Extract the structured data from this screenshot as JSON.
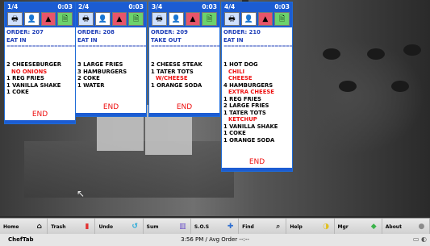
{
  "tickets": [
    {
      "count": "1/4",
      "time": "0:03",
      "order": "ORDER: 207",
      "type": "EAT IN",
      "dashes": "=========================",
      "items": [
        {
          "text": "2 CHEESEBURGER",
          "mod": false
        },
        {
          "text": "NO ONIONS",
          "mod": true
        },
        {
          "text": "1 REG FRIES",
          "mod": false
        },
        {
          "text": "1 VANILLA SHAKE",
          "mod": false
        },
        {
          "text": "1 COKE",
          "mod": false
        }
      ],
      "end": "END"
    },
    {
      "count": "2/4",
      "time": "0:03",
      "order": "ORDER: 208",
      "type": "EAT IN",
      "dashes": "=========================",
      "items": [
        {
          "text": "3 LARGE FRIES",
          "mod": false
        },
        {
          "text": "3 HAMBURGERS",
          "mod": false
        },
        {
          "text": "2 COKE",
          "mod": false
        },
        {
          "text": "1 WATER",
          "mod": false
        }
      ],
      "end": "END"
    },
    {
      "count": "3/4",
      "time": "0:03",
      "order": "ORDER: 209",
      "type": "TAKE OUT",
      "dashes": "=========================",
      "items": [
        {
          "text": "2 CHEESE STEAK",
          "mod": false
        },
        {
          "text": "1 TATER TOTS",
          "mod": false
        },
        {
          "text": "W/CHEESE",
          "mod": true
        },
        {
          "text": "1 ORANGE SODA",
          "mod": false
        }
      ],
      "end": "END"
    },
    {
      "count": "4/4",
      "time": "0:03",
      "order": "ORDER: 210",
      "type": "EAT IN",
      "dashes": "=========================",
      "items": [
        {
          "text": "1 HOT DOG",
          "mod": false
        },
        {
          "text": "CHILI",
          "mod": true
        },
        {
          "text": "CHEESE",
          "mod": true
        },
        {
          "text": "4 HAMBURGERS",
          "mod": false
        },
        {
          "text": "EXTRA CHEESE",
          "mod": true
        },
        {
          "text": "1 REG FRIES",
          "mod": false
        },
        {
          "text": "2 LARGE FRIES",
          "mod": false
        },
        {
          "text": "1 TATER TOTS",
          "mod": false
        },
        {
          "text": "KETCHUP",
          "mod": true
        },
        {
          "text": "1 VANILLA SHAKE",
          "mod": false
        },
        {
          "text": "1 COKE",
          "mod": false
        },
        {
          "text": "1 ORANGE SODA",
          "mod": false
        }
      ],
      "end": "END"
    }
  ],
  "ticket_icons": [
    "printer-icon",
    "user-icon",
    "flame-icon",
    "document-icon"
  ],
  "toolbar": [
    {
      "label": "Home",
      "icon": "home-icon",
      "glyph": "⌂",
      "color": "#1a1a1a"
    },
    {
      "label": "Trash",
      "icon": "trash-icon",
      "glyph": "▮",
      "color": "#e23030"
    },
    {
      "label": "Undo",
      "icon": "undo-icon",
      "glyph": "↺",
      "color": "#22a8d8"
    },
    {
      "label": "Sum",
      "icon": "sum-icon",
      "glyph": "▥",
      "color": "#6a4fc8"
    },
    {
      "label": "S.O.S",
      "icon": "sos-icon",
      "glyph": "✚",
      "color": "#2e6fd1"
    },
    {
      "label": "Find",
      "icon": "find-icon",
      "glyph": "⌕",
      "color": "#333333"
    },
    {
      "label": "Help",
      "icon": "help-icon",
      "glyph": "◑",
      "color": "#e0c020"
    },
    {
      "label": "Mgr",
      "icon": "manager-icon",
      "glyph": "◆",
      "color": "#3bb34a"
    },
    {
      "label": "About",
      "icon": "info-icon",
      "glyph": "●",
      "color": "#8a8a8a"
    }
  ],
  "status": {
    "app": "ChefTab",
    "center": "3:56 PM / Avg Order --:--",
    "sys": "▭ ◐"
  },
  "colors": {
    "ticket_header": "#1c5cd2",
    "modifier": "#ee1111",
    "order_text": "#1f3fb8"
  }
}
